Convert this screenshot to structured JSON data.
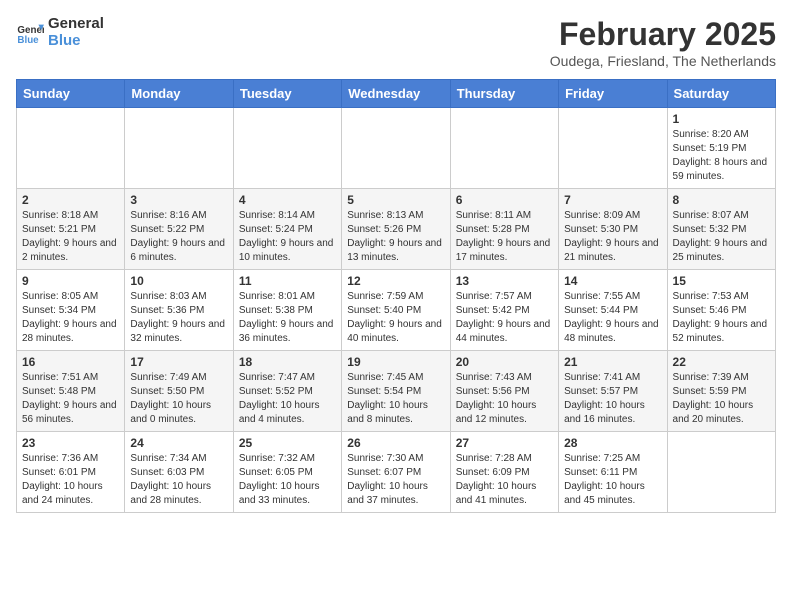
{
  "header": {
    "logo_line1": "General",
    "logo_line2": "Blue",
    "month_year": "February 2025",
    "location": "Oudega, Friesland, The Netherlands"
  },
  "days_of_week": [
    "Sunday",
    "Monday",
    "Tuesday",
    "Wednesday",
    "Thursday",
    "Friday",
    "Saturday"
  ],
  "weeks": [
    [
      {
        "num": "",
        "info": ""
      },
      {
        "num": "",
        "info": ""
      },
      {
        "num": "",
        "info": ""
      },
      {
        "num": "",
        "info": ""
      },
      {
        "num": "",
        "info": ""
      },
      {
        "num": "",
        "info": ""
      },
      {
        "num": "1",
        "info": "Sunrise: 8:20 AM\nSunset: 5:19 PM\nDaylight: 8 hours and 59 minutes."
      }
    ],
    [
      {
        "num": "2",
        "info": "Sunrise: 8:18 AM\nSunset: 5:21 PM\nDaylight: 9 hours and 2 minutes."
      },
      {
        "num": "3",
        "info": "Sunrise: 8:16 AM\nSunset: 5:22 PM\nDaylight: 9 hours and 6 minutes."
      },
      {
        "num": "4",
        "info": "Sunrise: 8:14 AM\nSunset: 5:24 PM\nDaylight: 9 hours and 10 minutes."
      },
      {
        "num": "5",
        "info": "Sunrise: 8:13 AM\nSunset: 5:26 PM\nDaylight: 9 hours and 13 minutes."
      },
      {
        "num": "6",
        "info": "Sunrise: 8:11 AM\nSunset: 5:28 PM\nDaylight: 9 hours and 17 minutes."
      },
      {
        "num": "7",
        "info": "Sunrise: 8:09 AM\nSunset: 5:30 PM\nDaylight: 9 hours and 21 minutes."
      },
      {
        "num": "8",
        "info": "Sunrise: 8:07 AM\nSunset: 5:32 PM\nDaylight: 9 hours and 25 minutes."
      }
    ],
    [
      {
        "num": "9",
        "info": "Sunrise: 8:05 AM\nSunset: 5:34 PM\nDaylight: 9 hours and 28 minutes."
      },
      {
        "num": "10",
        "info": "Sunrise: 8:03 AM\nSunset: 5:36 PM\nDaylight: 9 hours and 32 minutes."
      },
      {
        "num": "11",
        "info": "Sunrise: 8:01 AM\nSunset: 5:38 PM\nDaylight: 9 hours and 36 minutes."
      },
      {
        "num": "12",
        "info": "Sunrise: 7:59 AM\nSunset: 5:40 PM\nDaylight: 9 hours and 40 minutes."
      },
      {
        "num": "13",
        "info": "Sunrise: 7:57 AM\nSunset: 5:42 PM\nDaylight: 9 hours and 44 minutes."
      },
      {
        "num": "14",
        "info": "Sunrise: 7:55 AM\nSunset: 5:44 PM\nDaylight: 9 hours and 48 minutes."
      },
      {
        "num": "15",
        "info": "Sunrise: 7:53 AM\nSunset: 5:46 PM\nDaylight: 9 hours and 52 minutes."
      }
    ],
    [
      {
        "num": "16",
        "info": "Sunrise: 7:51 AM\nSunset: 5:48 PM\nDaylight: 9 hours and 56 minutes."
      },
      {
        "num": "17",
        "info": "Sunrise: 7:49 AM\nSunset: 5:50 PM\nDaylight: 10 hours and 0 minutes."
      },
      {
        "num": "18",
        "info": "Sunrise: 7:47 AM\nSunset: 5:52 PM\nDaylight: 10 hours and 4 minutes."
      },
      {
        "num": "19",
        "info": "Sunrise: 7:45 AM\nSunset: 5:54 PM\nDaylight: 10 hours and 8 minutes."
      },
      {
        "num": "20",
        "info": "Sunrise: 7:43 AM\nSunset: 5:56 PM\nDaylight: 10 hours and 12 minutes."
      },
      {
        "num": "21",
        "info": "Sunrise: 7:41 AM\nSunset: 5:57 PM\nDaylight: 10 hours and 16 minutes."
      },
      {
        "num": "22",
        "info": "Sunrise: 7:39 AM\nSunset: 5:59 PM\nDaylight: 10 hours and 20 minutes."
      }
    ],
    [
      {
        "num": "23",
        "info": "Sunrise: 7:36 AM\nSunset: 6:01 PM\nDaylight: 10 hours and 24 minutes."
      },
      {
        "num": "24",
        "info": "Sunrise: 7:34 AM\nSunset: 6:03 PM\nDaylight: 10 hours and 28 minutes."
      },
      {
        "num": "25",
        "info": "Sunrise: 7:32 AM\nSunset: 6:05 PM\nDaylight: 10 hours and 33 minutes."
      },
      {
        "num": "26",
        "info": "Sunrise: 7:30 AM\nSunset: 6:07 PM\nDaylight: 10 hours and 37 minutes."
      },
      {
        "num": "27",
        "info": "Sunrise: 7:28 AM\nSunset: 6:09 PM\nDaylight: 10 hours and 41 minutes."
      },
      {
        "num": "28",
        "info": "Sunrise: 7:25 AM\nSunset: 6:11 PM\nDaylight: 10 hours and 45 minutes."
      },
      {
        "num": "",
        "info": ""
      }
    ]
  ]
}
